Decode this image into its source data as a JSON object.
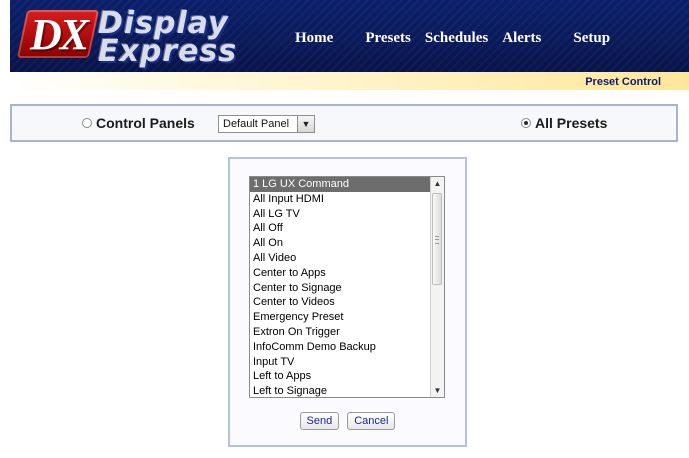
{
  "brand": {
    "mark": "DX",
    "line1": "Display",
    "line2": "Express"
  },
  "nav": {
    "items": [
      "Home",
      "Presets",
      "Schedules",
      "Alerts",
      "Setup"
    ]
  },
  "subheader": {
    "title": "Preset Control"
  },
  "controls": {
    "control_panels_label": "Control Panels",
    "control_panels_selected": false,
    "panel_select_value": "Default Panel",
    "all_presets_label": "All Presets",
    "all_presets_selected": true
  },
  "presets": {
    "selected_index": 0,
    "items": [
      "1 LG UX Command",
      "All Input HDMI",
      "All LG TV",
      "All Off",
      "All On",
      "All Video",
      "Center to Apps",
      "Center to Signage",
      "Center to Videos",
      "Emergency Preset",
      "Extron On Trigger",
      "InfoComm Demo Backup",
      "Input TV",
      "Left to Apps",
      "Left to Signage"
    ]
  },
  "actions": {
    "send_label": "Send",
    "cancel_label": "Cancel"
  },
  "icons": {
    "scroll_up": "triangle-up-icon",
    "scroll_down": "triangle-down-icon",
    "dropdown": "chevron-down-icon"
  }
}
